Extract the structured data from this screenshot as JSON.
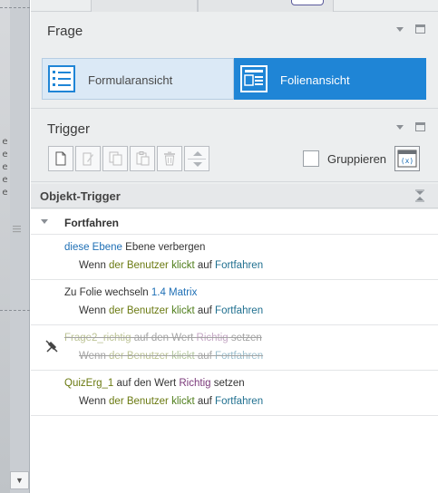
{
  "panels": {
    "frage": {
      "title": "Frage"
    },
    "trigger": {
      "title": "Trigger"
    }
  },
  "view_toggle": {
    "form_view": "Formularansicht",
    "slide_view": "Folienansicht",
    "selected": "Folienansicht"
  },
  "toolbar": {
    "buttons": [
      {
        "icon": "new-trigger-icon",
        "enabled": true
      },
      {
        "icon": "edit-trigger-icon",
        "enabled": false
      },
      {
        "icon": "copy-icon",
        "enabled": false
      },
      {
        "icon": "paste-icon",
        "enabled": false
      },
      {
        "icon": "delete-icon",
        "enabled": false
      },
      {
        "icon": "move-up-down-icon",
        "enabled": false
      }
    ],
    "group_label": "Gruppieren",
    "group_checked": false,
    "variables_icon": "variables-icon"
  },
  "list": {
    "header": "Objekt-Trigger",
    "group": "Fortfahren",
    "triggers": [
      {
        "line1": [
          {
            "text": "diese Ebene",
            "color": "#1e6fb5"
          },
          {
            "text": " Ebene verbergen",
            "color": "#333333"
          }
        ],
        "line2": [
          {
            "text": "Wenn ",
            "color": "#333333"
          },
          {
            "text": "der Benutzer",
            "color": "#6b7a12"
          },
          {
            "text": " ",
            "color": "#333333"
          },
          {
            "text": "klickt",
            "color": "#4e7d1a"
          },
          {
            "text": " auf ",
            "color": "#333333"
          },
          {
            "text": "Fortfahren",
            "color": "#1f6f8f"
          }
        ],
        "disabled": false
      },
      {
        "line1": [
          {
            "text": "Zu Folie wechseln ",
            "color": "#333333"
          },
          {
            "text": "1.4 Matrix",
            "color": "#1e6fb5"
          }
        ],
        "line2": [
          {
            "text": "Wenn ",
            "color": "#333333"
          },
          {
            "text": "der Benutzer",
            "color": "#6b7a12"
          },
          {
            "text": " ",
            "color": "#333333"
          },
          {
            "text": "klickt",
            "color": "#4e7d1a"
          },
          {
            "text": " auf ",
            "color": "#333333"
          },
          {
            "text": "Fortfahren",
            "color": "#1f6f8f"
          }
        ],
        "disabled": false
      },
      {
        "line1": [
          {
            "text": "Frage2_richtig",
            "color": "#6b7a12"
          },
          {
            "text": " auf den Wert ",
            "color": "#333333"
          },
          {
            "text": "Richtig",
            "color": "#7b3a7b"
          },
          {
            "text": " setzen",
            "color": "#333333"
          }
        ],
        "line2": [
          {
            "text": "Wenn ",
            "color": "#333333"
          },
          {
            "text": "der Benutzer",
            "color": "#6b7a12"
          },
          {
            "text": " ",
            "color": "#333333"
          },
          {
            "text": "klickt",
            "color": "#4e7d1a"
          },
          {
            "text": " auf ",
            "color": "#333333"
          },
          {
            "text": "Fortfahren",
            "color": "#1f6f8f"
          }
        ],
        "disabled": true
      },
      {
        "line1": [
          {
            "text": "QuizErg_1",
            "color": "#6b7a12"
          },
          {
            "text": " auf den Wert ",
            "color": "#333333"
          },
          {
            "text": "Richtig",
            "color": "#7b3a7b"
          },
          {
            "text": " setzen",
            "color": "#333333"
          }
        ],
        "line2": [
          {
            "text": "Wenn ",
            "color": "#333333"
          },
          {
            "text": "der Benutzer",
            "color": "#6b7a12"
          },
          {
            "text": " ",
            "color": "#333333"
          },
          {
            "text": "klickt",
            "color": "#4e7d1a"
          },
          {
            "text": " auf ",
            "color": "#333333"
          },
          {
            "text": "Fortfahren",
            "color": "#1f6f8f"
          }
        ],
        "disabled": false
      }
    ]
  },
  "colors": {
    "accent": "#1f85d6",
    "form_view_bg": "#dbe9f6",
    "panel_bg": "#eceeef"
  }
}
